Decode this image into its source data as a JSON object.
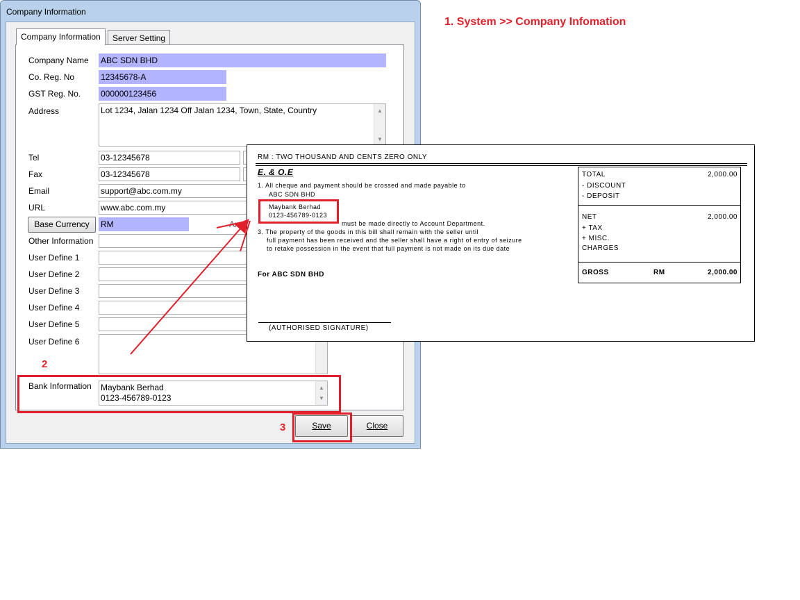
{
  "caption": "1. System >> Company Infomation",
  "window": {
    "title": "Company Information"
  },
  "tabs": [
    {
      "label": "Company Information",
      "active": true
    },
    {
      "label": "Server Setting",
      "active": false
    }
  ],
  "form": {
    "company_name": {
      "label": "Company Name",
      "value": "ABC SDN BHD"
    },
    "co_reg_no": {
      "label": "Co. Reg. No",
      "value": "12345678-A"
    },
    "gst_reg_no": {
      "label": "GST Reg. No.",
      "value": "000000123456"
    },
    "address": {
      "label": "Address",
      "value": "Lot 1234, Jalan 1234 Off Jalan 1234, Town, State, Country"
    },
    "tel": {
      "label": "Tel",
      "value": "03-12345678"
    },
    "fax": {
      "label": "Fax",
      "value": "03-12345678"
    },
    "email": {
      "label": "Email",
      "value": "support@abc.com.my"
    },
    "url": {
      "label": "URL",
      "value": "www.abc.com.my"
    },
    "base_currency": {
      "label": "Base Currency",
      "value": "RM"
    },
    "amount_label_partial": "Amo",
    "other_information": {
      "label": "Other Information",
      "value": ""
    },
    "user_define_1": {
      "label": "User Define 1",
      "value": ""
    },
    "user_define_2": {
      "label": "User Define 2",
      "value": ""
    },
    "user_define_3": {
      "label": "User Define 3",
      "value": ""
    },
    "user_define_4": {
      "label": "User Define 4",
      "value": ""
    },
    "user_define_5": {
      "label": "User Define 5",
      "value": ""
    },
    "user_define_6": {
      "label": "User Define 6",
      "value": ""
    },
    "bank_information": {
      "label": "Bank Information",
      "line1": "Maybank Berhad",
      "line2": "0123-456789-0123"
    }
  },
  "buttons": {
    "save": "Save",
    "close": "Close"
  },
  "annotations": {
    "step2": "2",
    "step3": "3",
    "color": "#e0202a"
  },
  "invoice": {
    "amount_words": "RM :  TWO THOUSAND AND CENTS ZERO ONLY",
    "eoe": "E. & O.E",
    "note1": "1. All cheque and payment should be crossed and made payable to",
    "note1_payee": "ABC SDN BHD",
    "bank_line1": "Maybank Berhad",
    "bank_line2": "0123-456789-0123",
    "note2_tail": "must be made directly to Account Department.",
    "note3_a": "3. The property of the goods in this bill shall remain with the seller until",
    "note3_b": "full payment has been received and the seller shall have a right of entry of seizure",
    "note3_c": "to retake possession in the event that full payment is not made on its due date",
    "for_label": "For  ABC SDN BHD",
    "signature": "(AUTHORISED SIGNATURE)",
    "total_label": "TOTAL",
    "total_value": "2,000.00",
    "discount_label": "-  DISCOUNT",
    "deposit_label": "-  DEPOSIT",
    "net_label": "NET",
    "net_value": "2,000.00",
    "tax_label": "+ TAX",
    "misc_label": "+ MISC.",
    "charges_label": "CHARGES",
    "gross_label": "GROSS",
    "gross_currency": "RM",
    "gross_value": "2,000.00"
  }
}
